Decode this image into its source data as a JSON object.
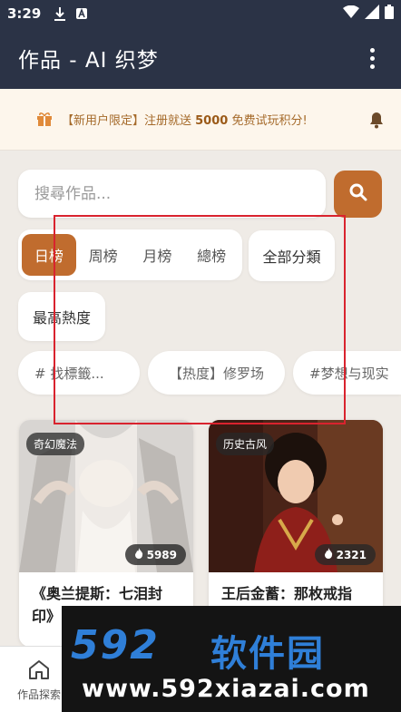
{
  "status_bar": {
    "time": "3:29"
  },
  "app_bar": {
    "title": "作品 - AI 织梦"
  },
  "notice": {
    "prefix": "【新用户限定】注册就送 ",
    "amount": "5000",
    "suffix": " 免费试玩积分!"
  },
  "search": {
    "placeholder": "搜尋作品..."
  },
  "rank_tabs": [
    "日榜",
    "周榜",
    "月榜",
    "總榜"
  ],
  "category_chip": "全部分類",
  "sort_chip": "最高熱度",
  "tag_chips": [
    "# 找標籤...",
    "【热度】修罗场",
    "#梦想与现实"
  ],
  "cards": [
    {
      "tag": "奇幻魔法",
      "heat": "5989",
      "title": "《奥兰提斯：七泪封印》"
    },
    {
      "tag": "历史古风",
      "heat": "2321",
      "title": "王后金蓄：那枚戒指"
    }
  ],
  "bottom_nav": [
    {
      "label": "作品探索"
    }
  ],
  "watermark": {
    "logo": "592",
    "cn": "软件园",
    "url": "www.592xiazai.com"
  },
  "colors": {
    "app_bar": "#2b3346",
    "accent": "#c06c2e",
    "notice_bg": "#fdf6ec",
    "annotation": "#d9232e"
  }
}
